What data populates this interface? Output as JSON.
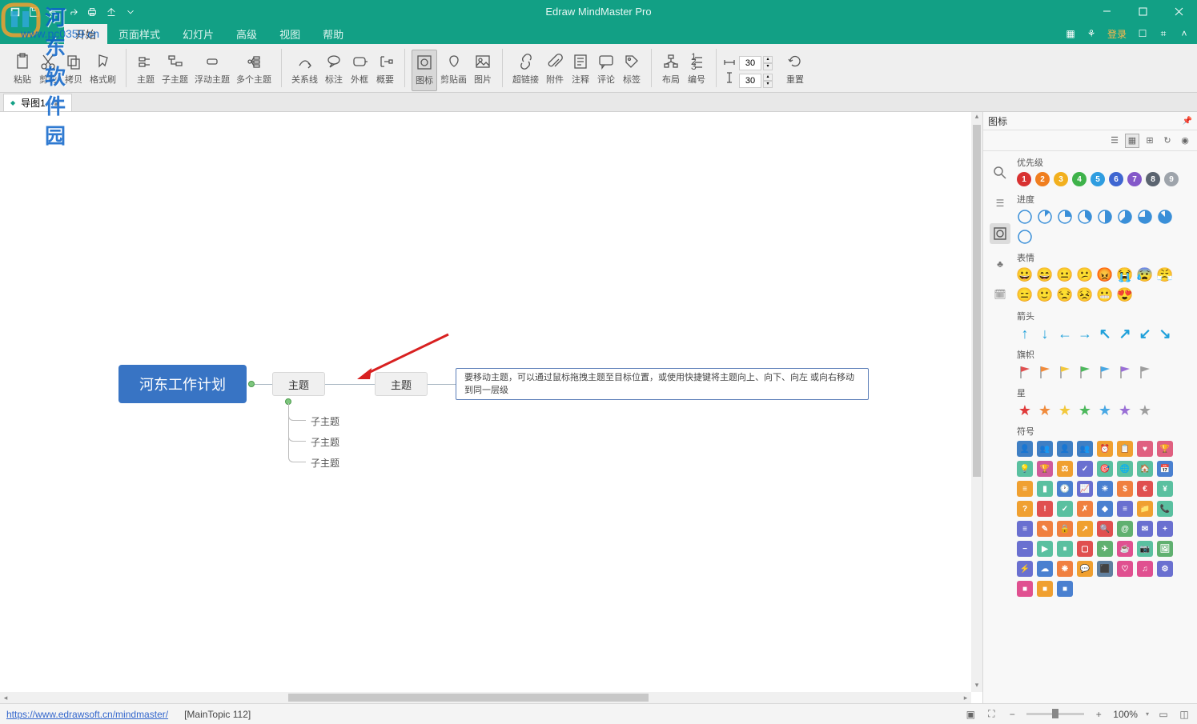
{
  "app_title": "Edraw MindMaster Pro",
  "watermark": {
    "text1": "河东软件园",
    "text2": "www.pc0359.cn"
  },
  "menubar": {
    "items": [
      "开始",
      "页面样式",
      "幻灯片",
      "高级",
      "视图",
      "帮助"
    ],
    "active_index": 0,
    "login": "登录"
  },
  "toolbar": {
    "groups": [
      [
        {
          "id": "paste",
          "label": "粘贴"
        },
        {
          "id": "cut",
          "label": "剪切"
        },
        {
          "id": "copy",
          "label": "拷贝"
        },
        {
          "id": "format-painter",
          "label": "格式刷"
        }
      ],
      [
        {
          "id": "topic",
          "label": "主题"
        },
        {
          "id": "subtopic",
          "label": "子主题"
        },
        {
          "id": "floating-topic",
          "label": "浮动主题"
        },
        {
          "id": "multi-topic",
          "label": "多个主题"
        }
      ],
      [
        {
          "id": "relation",
          "label": "关系线"
        },
        {
          "id": "callout",
          "label": "标注"
        },
        {
          "id": "boundary",
          "label": "外框"
        },
        {
          "id": "summary",
          "label": "概要"
        }
      ],
      [
        {
          "id": "icon",
          "label": "图标",
          "active": true
        },
        {
          "id": "clipart",
          "label": "剪贴画"
        },
        {
          "id": "picture",
          "label": "图片"
        }
      ],
      [
        {
          "id": "hyperlink",
          "label": "超链接"
        },
        {
          "id": "attachment",
          "label": "附件"
        },
        {
          "id": "note",
          "label": "注释"
        },
        {
          "id": "comment",
          "label": "评论"
        },
        {
          "id": "tag",
          "label": "标签"
        }
      ],
      [
        {
          "id": "layout",
          "label": "布局"
        },
        {
          "id": "numbering",
          "label": "编号"
        }
      ],
      [
        {
          "id": "width",
          "value": "30"
        },
        {
          "id": "height",
          "value": "30"
        }
      ],
      [
        {
          "id": "reset",
          "label": "重置"
        }
      ]
    ]
  },
  "doctab": {
    "name": "导图1",
    "dirty": true
  },
  "mindmap": {
    "central": "河东工作计划",
    "topic1": "主题",
    "topic2": "主题",
    "subs": [
      "子主题",
      "子主题",
      "子主题"
    ],
    "tooltip": "要移动主题，可以通过鼠标拖拽主题至目标位置，或使用快捷键将主题向上、向下、向左 或向右移动到同一层级"
  },
  "right_panel": {
    "title": "图标",
    "sections": {
      "priority": {
        "title": "优先级",
        "items": [
          "1",
          "2",
          "3",
          "4",
          "5",
          "6",
          "7",
          "8",
          "9"
        ],
        "colors": [
          "#d83131",
          "#f07e1f",
          "#f2b01e",
          "#3eb24a",
          "#2f9de0",
          "#3f66d1",
          "#8458c9",
          "#5b6470",
          "#9ea4ab"
        ]
      },
      "progress": {
        "title": "进度",
        "count": 9
      },
      "face": {
        "title": "表情",
        "items": [
          "😀",
          "😄",
          "😐",
          "😕",
          "😡",
          "😭",
          "😰",
          "😤",
          "😑",
          "🙂",
          "😒",
          "😣",
          "😬",
          "😍"
        ]
      },
      "arrow": {
        "title": "箭头",
        "items": [
          "↑",
          "↓",
          "←",
          "→",
          "↖",
          "↗",
          "↙",
          "↘"
        ],
        "color": "#1fa0da"
      },
      "flag": {
        "title": "旗帜",
        "colors": [
          "#e05050",
          "#f08b3c",
          "#f2c83c",
          "#4cb85c",
          "#48a8e4",
          "#9a6fd6",
          "#9e9e9e"
        ]
      },
      "star": {
        "title": "星",
        "colors": [
          "#e03a3a",
          "#f08b3c",
          "#f2c83c",
          "#4cb85c",
          "#48a8e4",
          "#9a6fd6",
          "#9e9e9e"
        ]
      },
      "symbol": {
        "title": "符号",
        "colors": [
          "#3f7fc4",
          "#3f7fc4",
          "#3f7fc4",
          "#3f7fc4",
          "#f0a030",
          "#f0a030",
          "#e06080",
          "#e06080",
          "#5ac0a0",
          "#d05a9a",
          "#f0a030",
          "#6a70d0",
          "#5ac0a0",
          "#5ac0a0",
          "#5ac0a0",
          "#4a80d0",
          "#f0a030",
          "#5ac0a0",
          "#4a80d0",
          "#6a70d0",
          "#4a80d0",
          "#f08040",
          "#e05050",
          "#5ac0a0",
          "#f0a030",
          "#e05050",
          "#5ac0a0",
          "#f08040",
          "#4a80d0",
          "#6a70d0",
          "#f0a030",
          "#5ac0a0",
          "#6a70d0",
          "#f08040",
          "#f08040",
          "#f0a030",
          "#e05050",
          "#60b070",
          "#6a70d0",
          "#6a70d0",
          "#6a70d0",
          "#5ac0a0",
          "#5ac0a0",
          "#e05050",
          "#60b070",
          "#e05090",
          "#5ac0a0",
          "#60b070",
          "#6a70d0",
          "#4a80d0",
          "#f08040",
          "#f0a030",
          "#6080a0",
          "#e05090",
          "#e05090",
          "#6a70d0",
          "#e05090",
          "#f0a030",
          "#4a80d0"
        ]
      }
    }
  },
  "statusbar": {
    "url": "https://www.edrawsoft.cn/mindmaster/",
    "context": "[MainTopic 112]",
    "zoom": "100%"
  }
}
